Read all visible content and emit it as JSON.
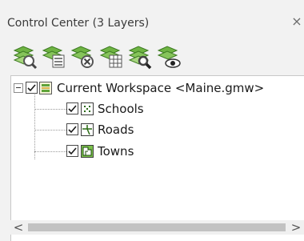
{
  "window": {
    "title": "Control Center (3 Layers)",
    "close_glyph": "×"
  },
  "toolbar": {
    "buttons": [
      {
        "name": "zoom-to-layer",
        "icon": "layer-magnifier-icon"
      },
      {
        "name": "layer-properties",
        "icon": "layer-list-icon"
      },
      {
        "name": "remove-layer",
        "icon": "layer-remove-icon"
      },
      {
        "name": "layer-table",
        "icon": "layer-table-icon"
      },
      {
        "name": "find-in-layer",
        "icon": "layer-search-icon"
      },
      {
        "name": "layer-visibility",
        "icon": "layer-eye-icon"
      }
    ]
  },
  "tree": {
    "workspace": {
      "label": "Current Workspace <Maine.gmw>",
      "checked": true,
      "expanded": true
    },
    "layers": [
      {
        "label": "Schools",
        "checked": true,
        "icon": "point-layer-icon"
      },
      {
        "label": "Roads",
        "checked": true,
        "icon": "line-layer-icon"
      },
      {
        "label": "Towns",
        "checked": true,
        "icon": "polygon-layer-icon"
      }
    ]
  },
  "scrollbar": {
    "left_glyph": "<",
    "right_glyph": ">"
  },
  "colors": {
    "icon_green": "#5fa33a",
    "checkbox_border": "#4a4a4a",
    "panel_background": "#f2f2f2"
  }
}
